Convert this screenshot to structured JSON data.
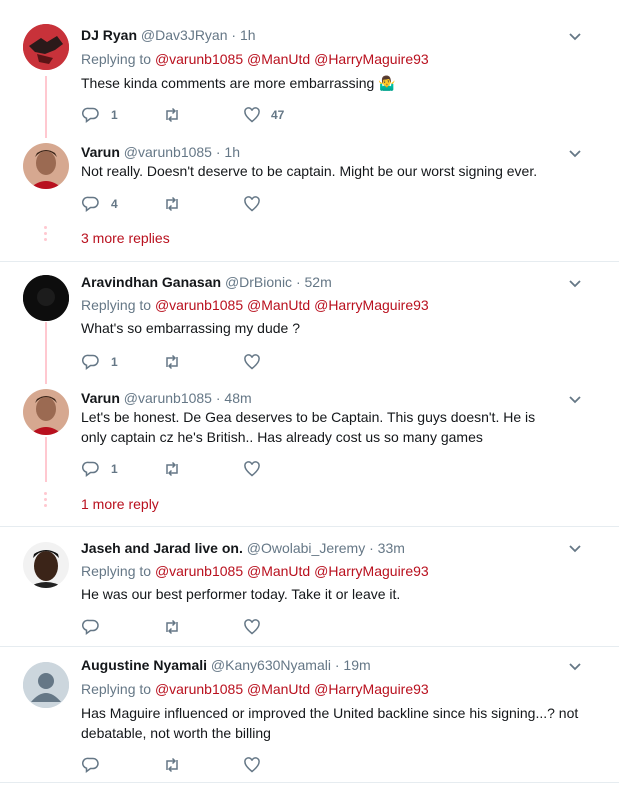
{
  "colors": {
    "accent": "#b9101e",
    "muted": "#657786",
    "text": "#14171a",
    "thread_line": "#ffc8d0"
  },
  "threads": [
    {
      "tweets": [
        {
          "name": "DJ Ryan",
          "handle": "@Dav3JRyan · 1h",
          "replying_prefix": "Replying to",
          "mentions": "@varunb1085 @ManUtd @HarryMaguire93",
          "text": "These kinda comments are more embarrassing 🤷‍♂️",
          "replies": "1",
          "retweets": "",
          "likes": "47"
        },
        {
          "name": "Varun",
          "handle": "@varunb1085 · 1h",
          "text": "Not really. Doesn't deserve to be captain. Might be our worst signing ever.",
          "replies": "4",
          "retweets": "",
          "likes": ""
        }
      ],
      "more_label": "3 more replies"
    },
    {
      "tweets": [
        {
          "name": "Aravindhan Ganasan",
          "handle": "@DrBionic · 52m",
          "replying_prefix": "Replying to",
          "mentions": "@varunb1085 @ManUtd @HarryMaguire93",
          "text": "What's so embarrassing my dude ?",
          "replies": "1",
          "retweets": "",
          "likes": ""
        },
        {
          "name": "Varun",
          "handle": "@varunb1085 · 48m",
          "text": "Let's be honest. De Gea deserves to be Captain. This guys doesn't. He is only captain cz he's British.. Has already cost us so many games",
          "replies": "1",
          "retweets": "",
          "likes": ""
        }
      ],
      "more_label": "1 more reply"
    },
    {
      "tweets": [
        {
          "name": "Jaseh and Jarad live on.",
          "handle": "@Owolabi_Jeremy · 33m",
          "replying_prefix": "Replying to",
          "mentions": "@varunb1085 @ManUtd @HarryMaguire93",
          "text": "He was our best performer today. Take it or leave it.",
          "replies": "",
          "retweets": "",
          "likes": ""
        }
      ]
    },
    {
      "tweets": [
        {
          "name": "Augustine Nyamali",
          "handle": "@Kany630Nyamali · 19m",
          "replying_prefix": "Replying to",
          "mentions": "@varunb1085 @ManUtd @HarryMaguire93",
          "text": "Has Maguire influenced or improved the United backline since his signing...? not debatable, not worth the billing",
          "replies": "",
          "retweets": "",
          "likes": ""
        }
      ]
    }
  ],
  "icons": {
    "reply": "reply-icon",
    "retweet": "retweet-icon",
    "like": "heart-icon",
    "menu": "chevron-down-icon"
  }
}
